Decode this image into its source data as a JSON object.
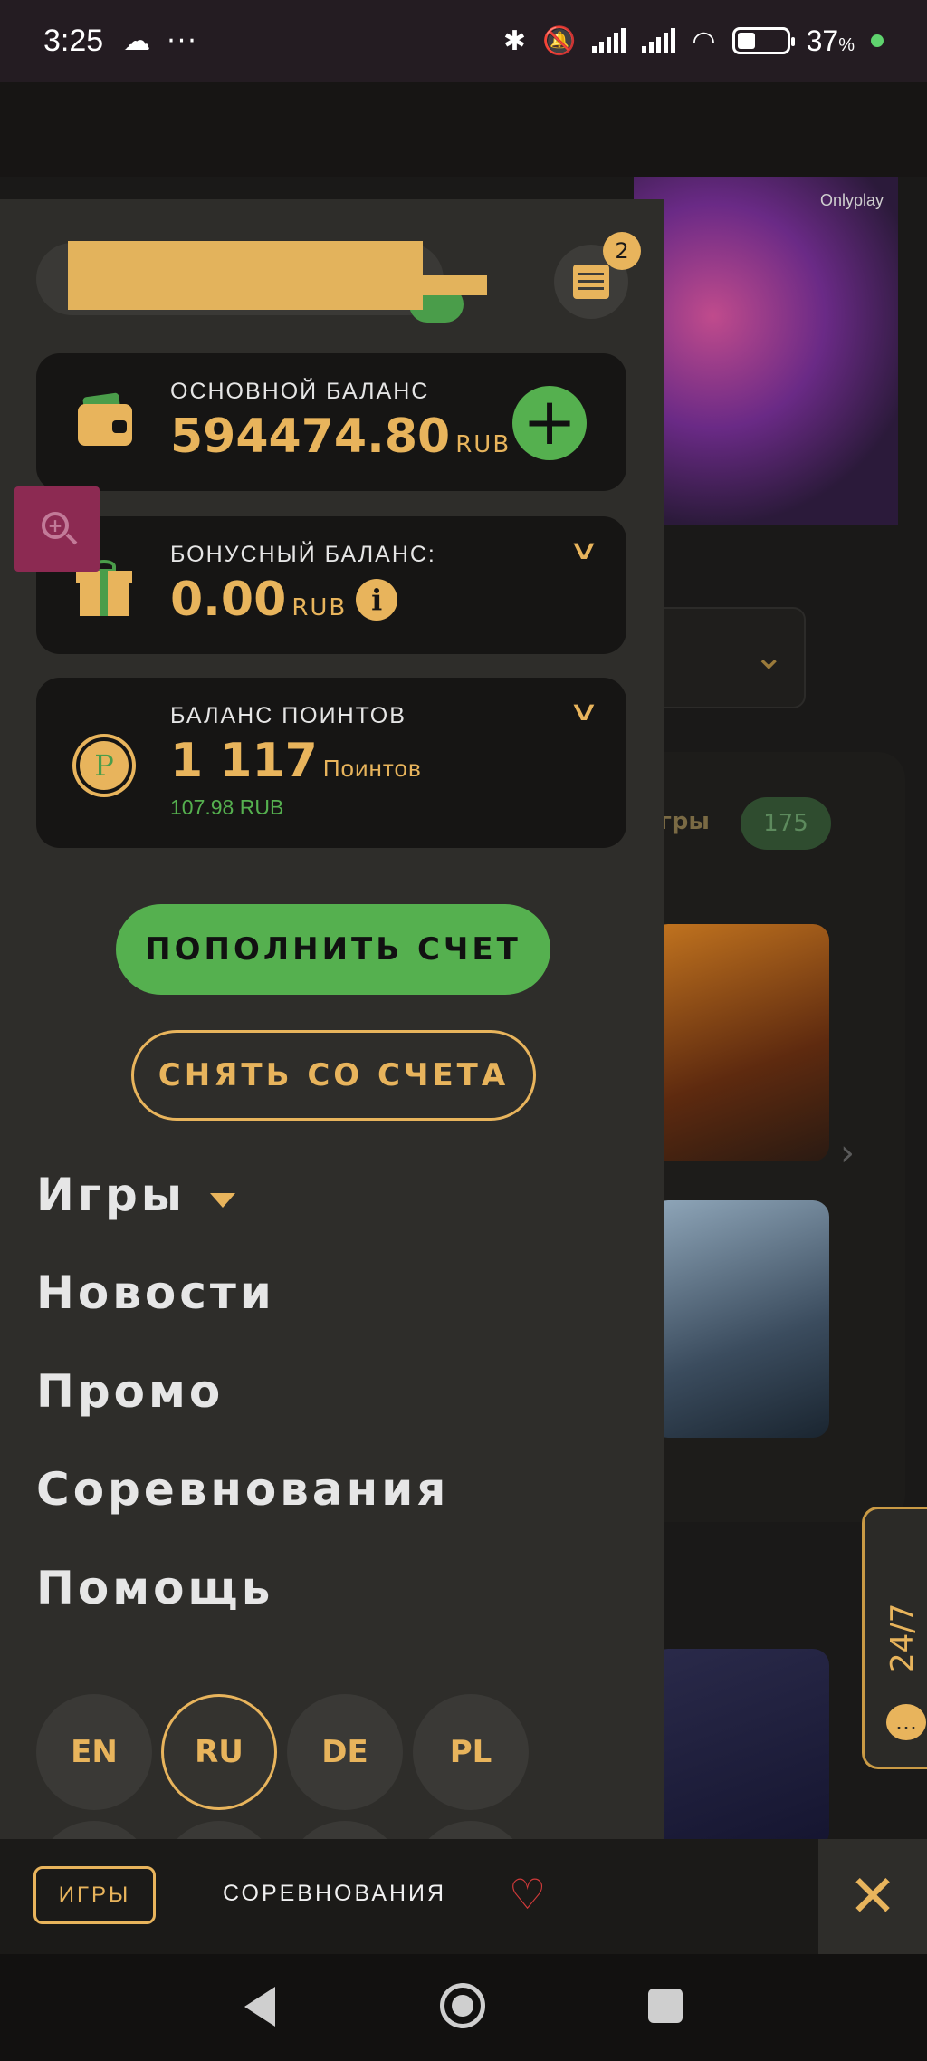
{
  "status_bar": {
    "time": "3:25",
    "battery": "37",
    "battery_unit": "%"
  },
  "background": {
    "banner_brand": "Onlyplay",
    "games_label": "игры",
    "games_count": "175",
    "support_label": "24/7"
  },
  "drawer": {
    "notifications_count": "2",
    "main_balance": {
      "label": "ОСНОВНОЙ БАЛАНС",
      "amount": "594474.80",
      "currency": "RUB"
    },
    "bonus_balance": {
      "label": "БОНУСНЫЙ БАЛАНС:",
      "amount": "0.00",
      "currency": "RUB"
    },
    "points_balance": {
      "label": "БАЛАНС ПОИНТОВ",
      "amount": "1 117",
      "unit": "Поинтов",
      "equivalent": "107.98 RUB"
    },
    "deposit_label": "ПОПОЛНИТЬ СЧЕТ",
    "withdraw_label": "СНЯТЬ СО СЧЕТА",
    "menu": [
      "Игры",
      "Новости",
      "Промо",
      "Соревнования",
      "Помощь"
    ],
    "languages": [
      "EN",
      "RU",
      "DE",
      "PL"
    ],
    "active_language": "RU"
  },
  "tabbar": {
    "games": "ИГРЫ",
    "competitions": "СОРЕВНОВАНИЯ"
  },
  "colors": {
    "accent": "#e8b45c",
    "positive": "#55b04f",
    "drawer_bg": "#2e2d2a",
    "card_bg": "#161514"
  }
}
